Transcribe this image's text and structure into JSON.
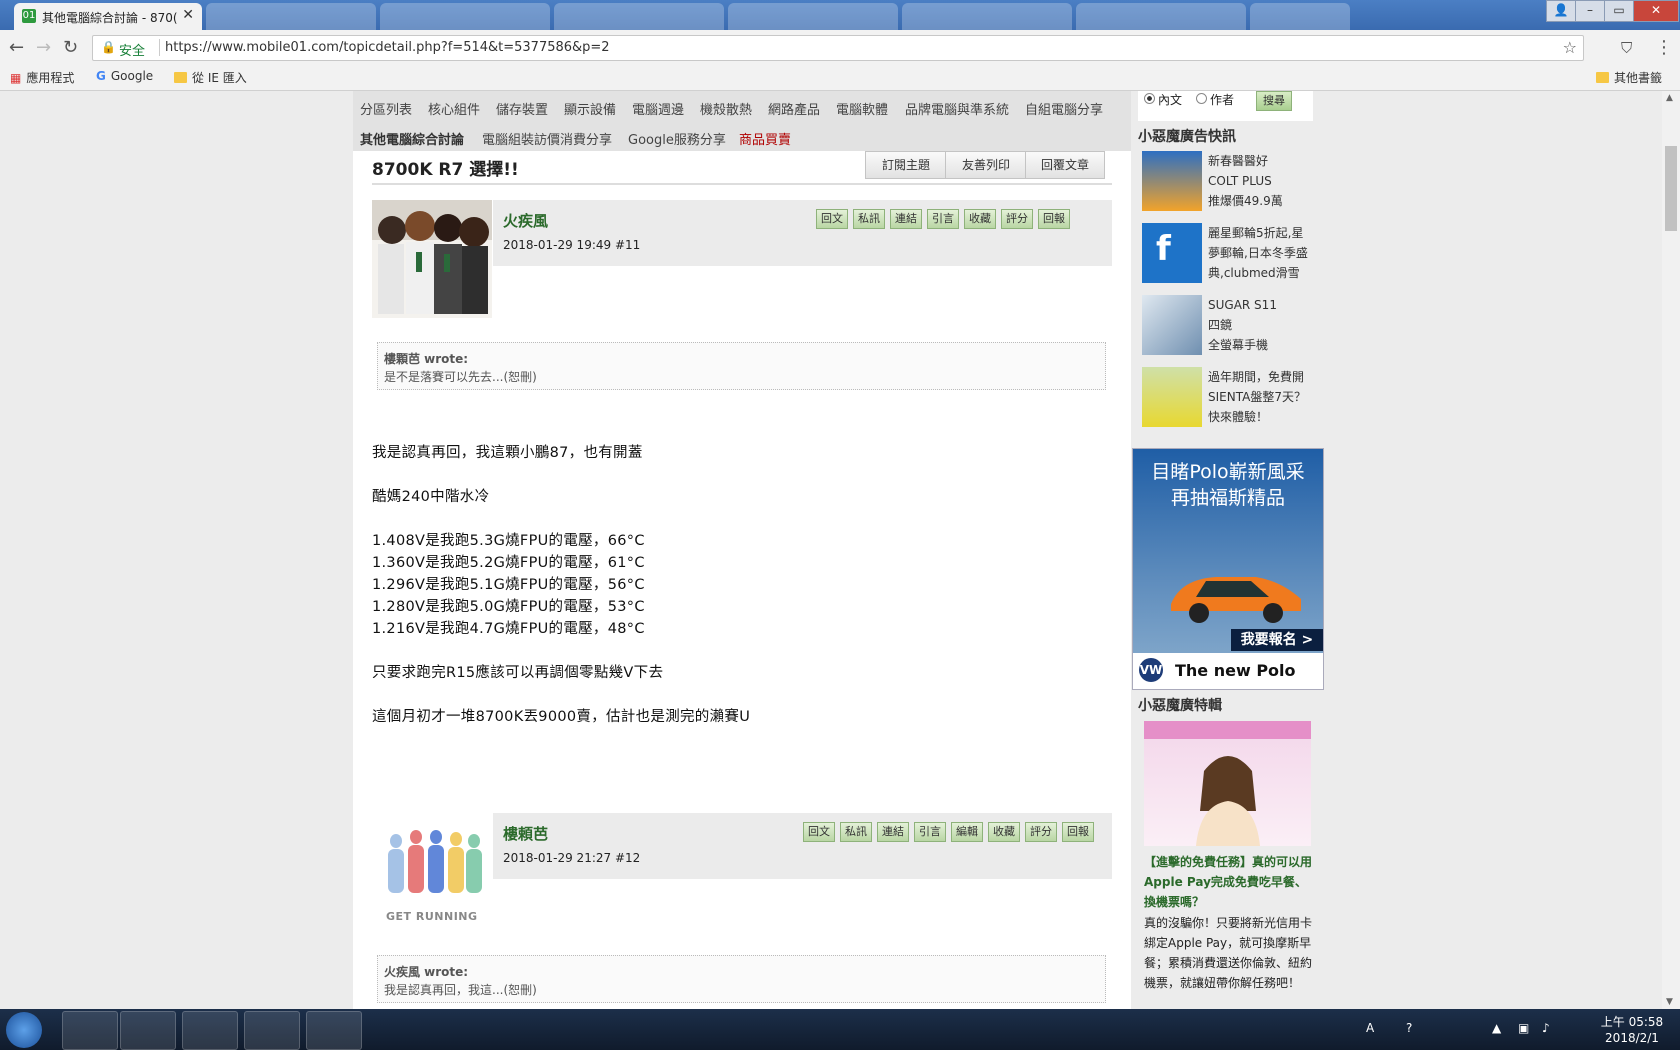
{
  "browser": {
    "active_tab_title": "其他電腦綜合討論 - 870(",
    "security_label": "安全",
    "url": "https://www.mobile01.com/topicdetail.php?f=514&t=5377586&p=2",
    "bookmarks": [
      "應用程式",
      "Google",
      "從 IE 匯入"
    ],
    "other_bookmarks": "其他書籤"
  },
  "categories": {
    "row1": [
      "分區列表",
      "核心組件",
      "儲存裝置",
      "顯示設備",
      "電腦週邊",
      "機殼散熱",
      "網路產品",
      "電腦軟體",
      "品牌電腦與準系統",
      "自組電腦分享"
    ],
    "row2": [
      "其他電腦綜合討論",
      "電腦組裝訪價消費分享",
      "Google服務分享",
      "商品買賣"
    ]
  },
  "topic": {
    "title": "8700K R7 選擇!!",
    "buttons": [
      "訂閱主題",
      "友善列印",
      "回覆文章"
    ]
  },
  "posts": [
    {
      "author": "火疾風",
      "meta": "2018-01-29 19:49  #11",
      "buttons": [
        "回文",
        "私訊",
        "連結",
        "引言",
        "收藏",
        "評分",
        "回報"
      ],
      "quote_author": "樓顆芭  wrote:",
      "quote_text": "是不是落賽可以先去...(恕刪)",
      "body": [
        "我是認真再回，我這顆小鵬87，也有開蓋",
        "酷媽240中階水冷",
        "1.408V是我跑5.3G燒FPU的電壓，66°C",
        "1.360V是我跑5.2G燒FPU的電壓，61°C",
        "1.296V是我跑5.1G燒FPU的電壓，56°C",
        "1.280V是我跑5.0G燒FPU的電壓，53°C",
        "1.216V是我跑4.7G燒FPU的電壓，48°C",
        "只要求跑完R15應該可以再調個零點幾V下去",
        "這個月初才一堆8700K丟9000賣，估計也是測完的瀨賽U"
      ]
    },
    {
      "author": "樓頼芭",
      "meta": "2018-01-29 21:27  #12",
      "buttons": [
        "回文",
        "私訊",
        "連結",
        "引言",
        "編輯",
        "收藏",
        "評分",
        "回報"
      ],
      "avatar_caption": "GET RUNNING",
      "quote_author": "火疾風  wrote:",
      "quote_text": "我是認真再回，我這...(恕刪)"
    }
  ],
  "sidebar": {
    "search_options": [
      "內文",
      "作者"
    ],
    "search_button": "搜尋",
    "ads_heading": "小惡魔廣告快訊",
    "ads": [
      [
        "新春醫醫好",
        "COLT PLUS",
        "推爆價49.9萬"
      ],
      [
        "麗星郵輪5折起,星",
        "夢郵輪,日本冬季盛",
        "典,clubmed滑雪"
      ],
      [
        "SUGAR S11",
        "四鏡",
        "全螢幕手機"
      ],
      [
        "過年期間，免費開",
        "SIENTA盤整7天？",
        "快來體驗！"
      ]
    ],
    "banner_headline": [
      "目睹Polo嶄新風采",
      "再抽福斯精品"
    ],
    "banner_cta": "我要報名 >",
    "banner_brand": "The new Polo",
    "feature_heading": "小惡魔廣特輯",
    "feature_title": "【進擊的免費任務】真的可以用Apple Pay完成免費吃早餐、換機票嗎？",
    "feature_desc": "真的沒騙你！只要將新光信用卡綁定Apple Pay，就可換摩斯早餐；累積消費還送你倫敦、紐約機票，就讓妞帶你解任務吧！"
  },
  "taskbar": {
    "clock_period_time": "上午 05:58",
    "clock_date": "2018/2/1"
  },
  "colors": {
    "author_green": "#2b6a2b",
    "sale_red": "#b00000",
    "titlebar_blue": "#3a6bb0"
  }
}
